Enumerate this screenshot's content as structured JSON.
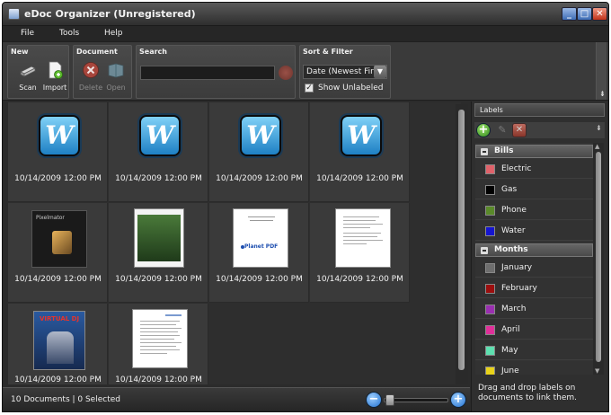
{
  "window": {
    "title": "eDoc Organizer (Unregistered)",
    "minimize": "_",
    "maximize": "□",
    "close": "✕"
  },
  "menu": [
    "File",
    "Tools",
    "Help"
  ],
  "ribbon": {
    "new": {
      "title": "New",
      "scan": "Scan",
      "import": "Import"
    },
    "document": {
      "title": "Document",
      "delete": "Delete",
      "open": "Open"
    },
    "search": {
      "title": "Search",
      "value": ""
    },
    "sort": {
      "title": "Sort & Filter",
      "selected": "Date (Newest First)",
      "show_unlabeled": "Show Unlabeled",
      "show_unlabeled_checked": true
    }
  },
  "documents": [
    {
      "type": "word",
      "date": "10/14/2009 12:00 PM"
    },
    {
      "type": "word",
      "date": "10/14/2009 12:00 PM"
    },
    {
      "type": "word",
      "date": "10/14/2009 12:00 PM"
    },
    {
      "type": "word",
      "date": "10/14/2009 12:00 PM"
    },
    {
      "type": "pixelmator",
      "date": "10/14/2009 12:00 PM"
    },
    {
      "type": "photo-page",
      "date": "10/14/2009 12:00 PM"
    },
    {
      "type": "planet-pdf",
      "date": "10/14/2009 12:00 PM"
    },
    {
      "type": "text-page",
      "date": "10/14/2009 12:00 PM"
    },
    {
      "type": "magazine",
      "date": "10/14/2009 12:00 PM"
    },
    {
      "type": "text-page",
      "date": "10/14/2009 12:00 PM"
    }
  ],
  "thumbs": {
    "pixelmator_text": "Pixelmator",
    "planet_pdf_text": "Planet PDF",
    "magazine_text": "VIRTUAL DJ"
  },
  "status": {
    "text": "10 Documents | 0 Selected",
    "zoom_out": "−",
    "zoom_in": "+"
  },
  "labels_panel": {
    "title": "Labels",
    "add": "+",
    "edit": "✎",
    "delete": "✕",
    "categories": [
      {
        "name": "Bills",
        "labels": [
          {
            "name": "Electric",
            "color": "#e0626a"
          },
          {
            "name": "Gas",
            "color": "#000000"
          },
          {
            "name": "Phone",
            "color": "#5a8a2a"
          },
          {
            "name": "Water",
            "color": "#1515d0"
          }
        ]
      },
      {
        "name": "Months",
        "labels": [
          {
            "name": "January",
            "color": "#6e6e6e"
          },
          {
            "name": "February",
            "color": "#9c0e0e"
          },
          {
            "name": "March",
            "color": "#9a2fb0"
          },
          {
            "name": "April",
            "color": "#e0309a"
          },
          {
            "name": "May",
            "color": "#5ee0b0"
          },
          {
            "name": "June",
            "color": "#e8d21a"
          }
        ]
      }
    ],
    "hint": "Drag and drop labels on documents to link them."
  }
}
